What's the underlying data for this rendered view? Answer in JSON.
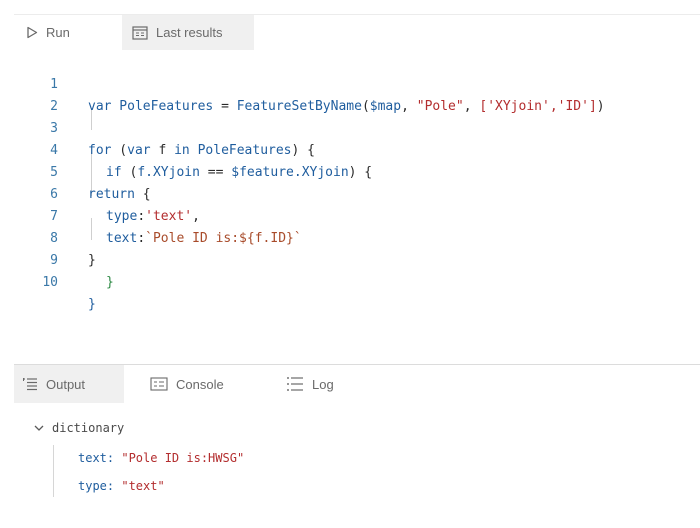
{
  "toolbar": {
    "run_label": "Run",
    "last_results_label": "Last results"
  },
  "editor": {
    "line_numbers": [
      "1",
      "2",
      "3",
      "4",
      "5",
      "6",
      "7",
      "8",
      "9",
      "10"
    ],
    "lines": {
      "l1": {
        "kw": "var",
        "name": " PoleFeatures ",
        "op": "= ",
        "fn": "FeatureSetByName",
        "open": "(",
        "arg1": "$map",
        "comma1": ", ",
        "arg2": "\"Pole\"",
        "comma2": ", ",
        "arg3": "['XYjoin','ID']",
        "close": ")"
      },
      "l3": {
        "kw": "for",
        "rest1": " (",
        "var": "var",
        "rest2": " f ",
        "in": "in",
        "rest3": " PoleFeatures",
        "rest4": ") {"
      },
      "l4": {
        "kw": "if",
        "rest1": " (",
        "expr": "f.XYjoin",
        "op": " == ",
        "expr2": "$feature.XYjoin",
        "rest2": ") {"
      },
      "l5": {
        "kw": "return",
        "rest": " {"
      },
      "l6": {
        "key": "type",
        "colon": ":",
        "val": "'text'",
        "comma": ","
      },
      "l7": {
        "key": "text",
        "colon": ":",
        "val": "`Pole ID is:${f.ID}`"
      },
      "l8": "}",
      "l9": "}",
      "l10": "}"
    }
  },
  "panel": {
    "tabs": [
      {
        "label": "Output"
      },
      {
        "label": "Console"
      },
      {
        "label": "Log"
      }
    ]
  },
  "output": {
    "root_label": "dictionary",
    "entries": [
      {
        "key": "text",
        "value": "\"Pole ID is:HWSG\""
      },
      {
        "key": "type",
        "value": "\"text\""
      }
    ]
  },
  "colors": {
    "keyword": "#1f5d9e",
    "string": "#b32d2e",
    "line_number": "#3a78a8",
    "tab_active_bg": "#f0f0f0"
  }
}
